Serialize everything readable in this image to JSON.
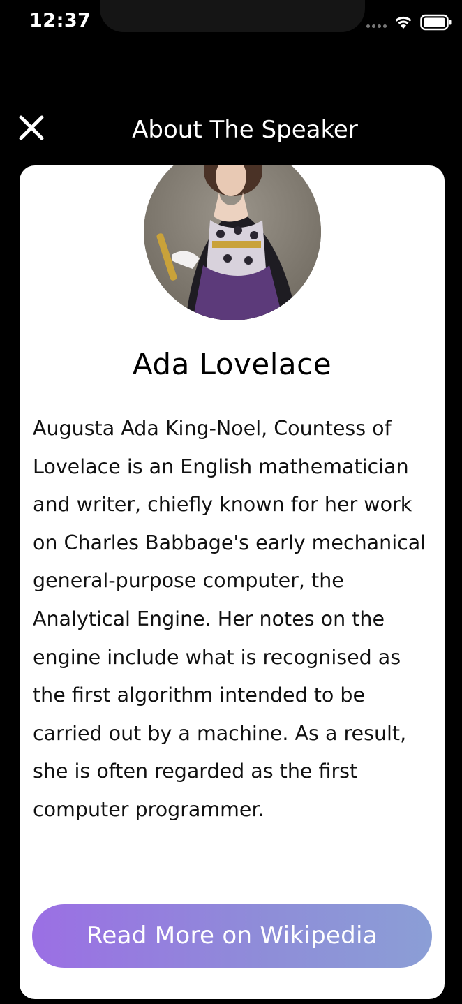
{
  "status_bar": {
    "time": "12:37"
  },
  "header": {
    "title": "About The Speaker",
    "close_icon": "close-icon"
  },
  "speaker": {
    "name": "Ada Lovelace",
    "bio": "Augusta Ada King-Noel, Countess of Lovelace is an English mathematician and writer, chiefly known for her work on Charles Babbage's early mechanical general-purpose computer, the Analytical Engine. Her notes on the engine include what is recognised as the first algorithm intended to be carried out by a machine. As a result, she is often regarded as the first computer programmer.",
    "avatar_icon": "speaker-portrait"
  },
  "actions": {
    "read_more_label": "Read More on Wikipedia"
  },
  "colors": {
    "background": "#000000",
    "card": "#ffffff",
    "button_gradient_start": "#9b6fe4",
    "button_gradient_end": "#8b9ed6"
  }
}
